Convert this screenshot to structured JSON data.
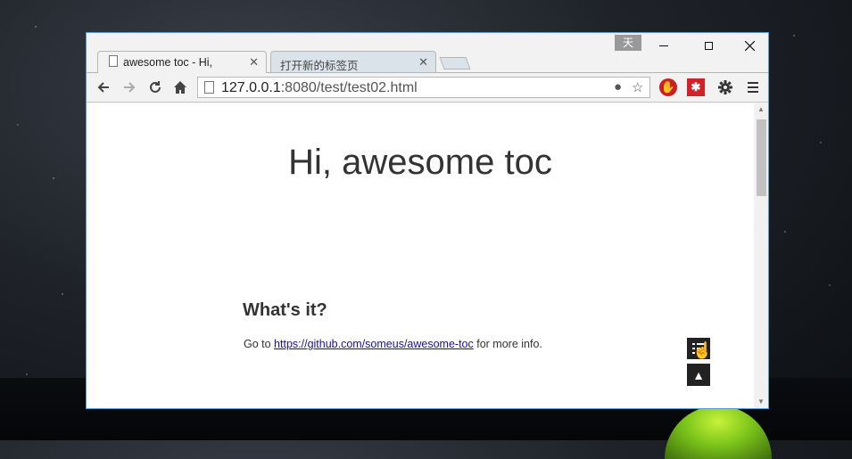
{
  "browser": {
    "ime_indicator": "天",
    "tabs": [
      {
        "title": "awesome toc - Hi,",
        "active": true
      },
      {
        "title": "打开新的标签页",
        "active": false
      }
    ],
    "address": {
      "host": "127.0.0.1",
      "rest": ":8080/test/test02.html"
    }
  },
  "page": {
    "title": "Hi, awesome toc",
    "section_heading": "What's it?",
    "para_prefix": "Go to ",
    "link_text": "https://github.com/someus/awesome-toc",
    "para_suffix": " for more info."
  },
  "icons": {
    "back": "back-arrow-icon",
    "forward": "forward-arrow-icon",
    "reload": "reload-icon",
    "home": "home-icon",
    "bookmark": "star-icon",
    "settings": "gear-icon",
    "menu": "hamburger-menu-icon",
    "toc": "toc-list-icon",
    "scroll_top": "triangle-up-icon"
  }
}
